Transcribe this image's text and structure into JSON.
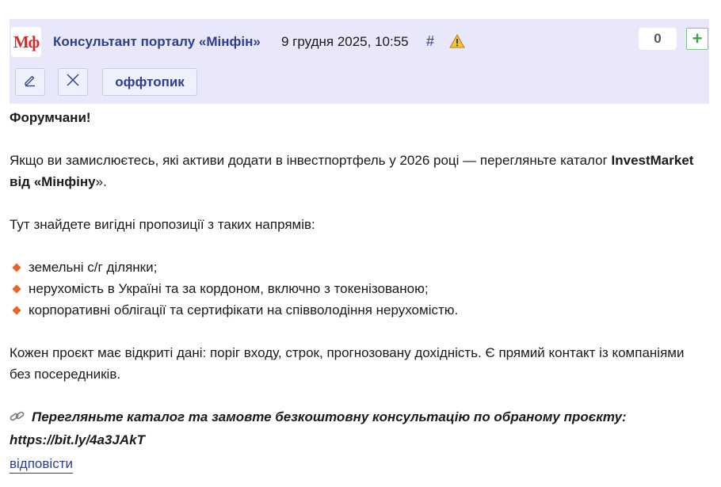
{
  "header": {
    "logo_text": "Мф",
    "author": "Консультант порталу «Мінфін»",
    "timestamp": "9 грудня 2025, 10:55",
    "hash": "#",
    "warning_icon": "warning-icon",
    "score": "0",
    "plus_label": "+",
    "tag": "оффтопик",
    "edit_icon": "pencil-icon",
    "close_icon": "close-icon"
  },
  "post": {
    "greeting": "Форумчани!",
    "intro_text": "Якщо ви замислюєтесь, які активи додати в інвестпортфель у 2026 році — перегляньте каталог ",
    "intro_bold_1": "InvestMarket від «Мінфіну",
    "intro_end": "».",
    "directions_intro": "Тут знайдете вигідні пропозиції з таких напрямів:",
    "directions": [
      "земельні с/г ділянки;",
      "нерухомість в Україні та за кордоном, включно з токенізованою;",
      "корпоративні облігації та сертифікати на співволодіння нерухомістю."
    ],
    "projects_text": "Кожен проєкт має відкриті дані: поріг входу, строк, прогнозовану дохідність. Є прямий контакт із компаніями без посередників.",
    "cta_text": "Перегляньте каталог та замовте безкоштовну консультацію по обраному проєкту:",
    "cta_link": "https://bit.ly/4a3JAkT"
  },
  "actions": {
    "reply_label": "відповісти"
  },
  "colors": {
    "header_bg": "#e8e8fa",
    "link": "#2d3f8c",
    "bullet": "#e8652a",
    "logo": "#d8262c"
  }
}
